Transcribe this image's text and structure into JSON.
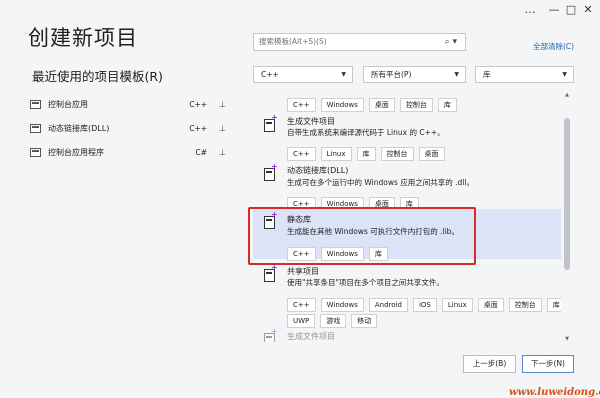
{
  "window": {
    "more_icon": "…",
    "minimize_icon": "—",
    "maximize_icon": "□",
    "close_icon": "✕"
  },
  "page": {
    "title": "创建新项目",
    "subtitle": "最近使用的项目模板(R)"
  },
  "recent": [
    {
      "name": "控制台应用",
      "lang": "C++",
      "pin": "⊥"
    },
    {
      "name": "动态链接库(DLL)",
      "lang": "C++",
      "pin": "⊥"
    },
    {
      "name": "控制台应用程序",
      "lang": "C#",
      "pin": "⊥"
    }
  ],
  "search": {
    "placeholder": "搜索模板(Alt+S)(S)",
    "icon": "search-icon"
  },
  "clear_all": "全部清除(C)",
  "filters": {
    "language": "C++",
    "platform": "所有平台(P)",
    "type": "库"
  },
  "templates": [
    {
      "name": "",
      "desc": "",
      "tags": [
        "C++",
        "Windows",
        "桌面",
        "控制台",
        "库"
      ]
    },
    {
      "name": "生成文件项目",
      "desc": "自带生成系统来编译源代码于 Linux 的 C++。",
      "tags": [
        "C++",
        "Linux",
        "库",
        "控制台",
        "桌面"
      ]
    },
    {
      "name": "动态链接库(DLL)",
      "desc": "生成可在多个运行中的 Windows 应用之间共享的 .dll。",
      "tags": [
        "C++",
        "Windows",
        "桌面",
        "库"
      ]
    },
    {
      "name": "静态库",
      "desc": "生成能在其他 Windows 可执行文件内打包的 .lib。",
      "tags": [
        "C++",
        "Windows",
        "库"
      ]
    },
    {
      "name": "共享项目",
      "desc": "使用\"共享条目\"项目在多个项目之间共享文件。",
      "tags": [
        "C++",
        "Windows",
        "Android",
        "iOS",
        "Linux",
        "桌面",
        "控制台",
        "库"
      ],
      "tags2": [
        "UWP",
        "游戏",
        "移动"
      ]
    },
    {
      "name": "生成文件项目",
      "desc": "",
      "tags": []
    }
  ],
  "buttons": {
    "back": "上一步(B)",
    "next": "下一步(N)"
  },
  "watermark": "www.luweidong.cn"
}
